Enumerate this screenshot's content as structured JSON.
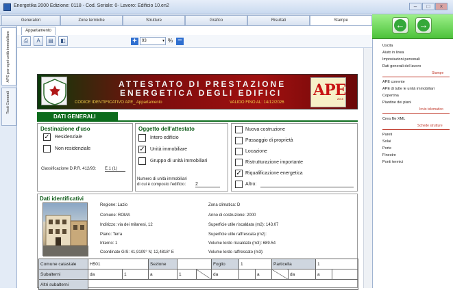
{
  "window": {
    "title": "Energetika 2000  Edizione: 0118 - Cod. Seriale: 0- Lavoro: Edificio 10.en2",
    "min": "–",
    "max": "□",
    "close": "×"
  },
  "tabs": [
    "Generatori",
    "Zone termiche",
    "Strutture",
    "Grafico",
    "Risultati",
    "Stampe"
  ],
  "subtab": "Appartamento",
  "toolbar": {
    "zoom": "93",
    "percent": "%"
  },
  "vtabs": [
    "APE per ogni unità immobiliare",
    "Testi Generali"
  ],
  "header": {
    "line1": "ATTESTATO DI PRESTAZIONE",
    "line2": "ENERGETICA DEGLI EDIFICI",
    "code": "CODICE IDENTIFICATIVO  APE_ Appartamento",
    "valid": "VALIDO FINO AL: 14/12/2026",
    "logo": "APE",
    "logo_sub": "2015"
  },
  "section1": "DATI GENERALI",
  "dest": {
    "title": "Destinazione d'uso",
    "res": "Residenziale",
    "nonres": "Non residenziale",
    "class_label": "Classificazione D.P.R. 412/93:",
    "class_value": "E.1 (1)"
  },
  "ogg": {
    "title": "Oggetto dell'attestato",
    "o1": "Intero edificio",
    "o2": "Unità immobiliare",
    "o3": "Gruppo di unità immobiliari",
    "num_label1": "Numero di unità immobiliari",
    "num_label2": "di cui è composto l'edificio:",
    "num_value": "2"
  },
  "motivo": {
    "m1": "Nuova costruzione",
    "m2": "Passaggio di proprietà",
    "m3": "Locazione",
    "m4": "Ristrutturazione importante",
    "m5": "Riqualificazione energetica",
    "m6": "Altro:"
  },
  "checks": {
    "res": true,
    "nonres": false,
    "o1": false,
    "o2": true,
    "o3": false,
    "m1": false,
    "m2": false,
    "m3": false,
    "m4": false,
    "m5": true,
    "m6": false
  },
  "ident": {
    "title": "Dati identificativi",
    "left": [
      "Regione: Lazio",
      "Comune: ROMA",
      "Indirizzo: via dei milanesi, 12",
      "Piano: Terra",
      "Interno: 1",
      "Coordinate GIS: 41,9109° N; 12,4818° E"
    ],
    "right": [
      "Zona climatica: D",
      "Anno di costruzione: 2000",
      "Superficie utile riscaldata (m2): 143.07",
      "Superficie utile raffrescata (m2):",
      "Volume lordo riscaldato (m3): 689.54",
      "Volume lordo raffrescato (m3):"
    ]
  },
  "grid": {
    "comune": "Comune catastale",
    "comune_val": "H501",
    "sezione": "Sezione",
    "foglio": "Foglio",
    "foglio_val": "1",
    "particella": "Particella",
    "particella_val": "1",
    "subalterni": "Subalterni",
    "altri": "Altri subalterni",
    "da": "da",
    "a": "a",
    "sub1_da": "1",
    "sub1_a": "1"
  },
  "rpanel": {
    "items1": [
      "Uscita",
      "Aiuto in linea",
      "Impostazioni personali",
      "Dati generali del lavoro"
    ],
    "group1": "Stampe",
    "items2": [
      "APE corrente",
      "APE di tutte le unità immobiliari",
      "Copertina",
      "Piantine dei piani"
    ],
    "group2": "Invio telematico",
    "items3": [
      "Crea file XML"
    ],
    "group3": "Schede strutture",
    "items4": [
      "Pareti",
      "Solai",
      "Porte",
      "Finestre",
      "Ponti termici"
    ]
  }
}
